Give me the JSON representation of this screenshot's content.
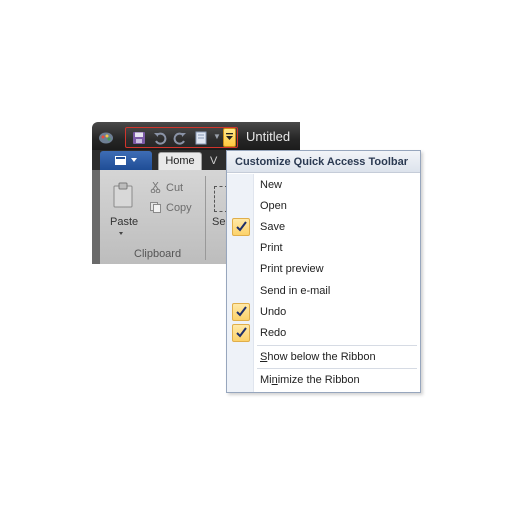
{
  "window": {
    "title": "Untitled"
  },
  "quick_access_toolbar": {
    "buttons": [
      "save-icon",
      "undo-icon",
      "redo-icon",
      "document-icon"
    ],
    "highlight_color": "#d0342c",
    "dropdown_highlight_color": "#ffc940"
  },
  "ribbon": {
    "tabs": [
      {
        "label": "Home",
        "active": true
      },
      {
        "label": "V",
        "active": false
      }
    ],
    "clipboard": {
      "paste_label": "Paste",
      "cut_label": "Cut",
      "copy_label": "Copy",
      "group_label": "Clipboard"
    },
    "select_label": "Sel"
  },
  "menu": {
    "header": "Customize Quick Access Toolbar",
    "items": [
      {
        "label": "New",
        "checked": false
      },
      {
        "label": "Open",
        "checked": false
      },
      {
        "label": "Save",
        "checked": true
      },
      {
        "label": "Print",
        "checked": false
      },
      {
        "label": "Print preview",
        "checked": false
      },
      {
        "label": "Send in e-mail",
        "checked": false
      },
      {
        "label": "Undo",
        "checked": true
      },
      {
        "label": "Redo",
        "checked": true
      }
    ],
    "show_below": {
      "label": "Show below the Ribbon",
      "mnemonic": "S"
    },
    "minimize": {
      "label": "Minimize the Ribbon",
      "mnemonic": "n"
    }
  }
}
